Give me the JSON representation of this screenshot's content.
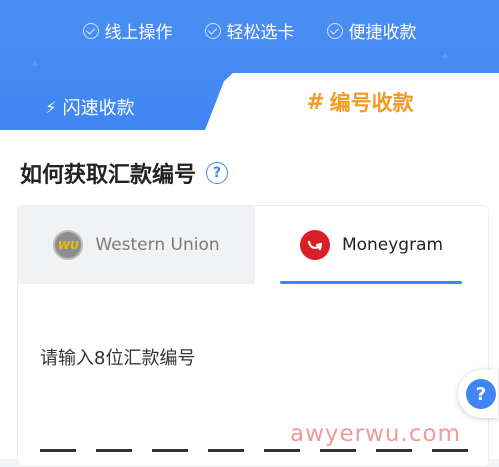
{
  "features": [
    {
      "label": "线上操作",
      "icon": "check-circle-icon"
    },
    {
      "label": "轻松选卡",
      "icon": "check-circle-icon"
    },
    {
      "label": "便捷收款",
      "icon": "check-circle-icon"
    }
  ],
  "tabs": {
    "fast_label": "闪速收款",
    "number_label": "编号收款"
  },
  "section": {
    "title": "如何获取汇款编号",
    "help_glyph": "?"
  },
  "payment_tabs": {
    "western_union": {
      "label": "Western Union",
      "logo_text": "WU"
    },
    "moneygram": {
      "label": "Moneygram"
    }
  },
  "input": {
    "label": "请输入8位汇款编号",
    "slot_count": 8
  },
  "watermark": "awyerwu.com",
  "colors": {
    "primary": "#3f86f2",
    "accent_orange": "#f29a24",
    "moneygram_red": "#d91f26"
  }
}
